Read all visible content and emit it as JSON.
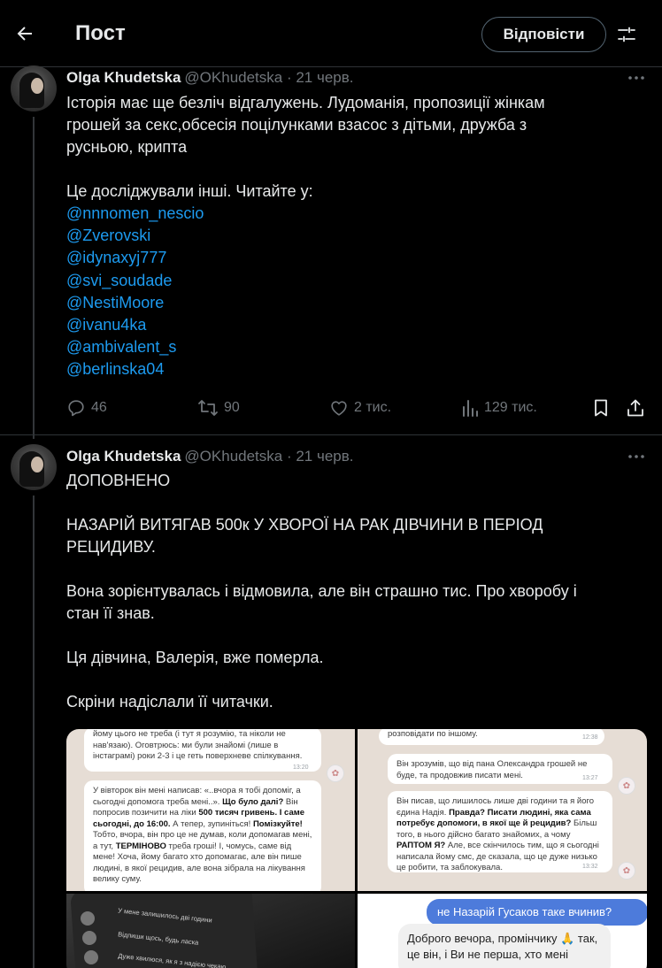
{
  "header": {
    "title": "Пост",
    "reply_label": "Відповісти"
  },
  "tweets": [
    {
      "author": "Olga Khudetska",
      "meta": "@OKhudetska · 21 черв.",
      "lines": [
        "Історія має ще безліч відгалужень. Лудоманія, пропозиції жінкам",
        "грошей за секс,обсесія поцілунками взасос з дітьми, дружба з",
        "русньою, крипта",
        "Це досліджували інші. Читайте у:"
      ],
      "mentions": [
        "@nnnomen_nescio",
        "@Zverovski",
        "@idynaxyj777",
        "@svi_soudade",
        "@NestiMoore",
        "@ivanu4ka",
        "@ambivalent_s",
        "@berlinska04"
      ],
      "stats": {
        "replies": "46",
        "reposts": "90",
        "likes": "2 тис.",
        "views": "129 тис."
      }
    },
    {
      "author": "Olga Khudetska",
      "meta": "@OKhudetska · 21 черв.",
      "lines": [
        "ДОПОВНЕНО",
        "НАЗАРІЙ ВИТЯГАВ 500к У ХВОРОЇ НА РАК ДІВЧИНИ В ПЕРІОД",
        "РЕЦИДИВУ.",
        "Вона зорієнтувалась і відмовила, але він страшно тис. Про хворобу і",
        "стан її знав.",
        "Ця дівчина, Валерія,  вже померла.",
        "Скріни надіслали її читачки."
      ],
      "media": {
        "img1": {
          "b1": "йому цього не треба (і тут я розумію, та ніколи не нав'язаю). Оговтрюсь: ми були знайомі (лише в інстаграмі) роки 2-3 і це геть поверхневе спілкування.",
          "b1_time": "13:20",
          "b2_a": "У вівторок він мені написав: «..вчора я тобі допоміг, а сьогодні допомога треба мені..». ",
          "b2_b": "Що було далі?",
          "b2_c": " Він попросив позичити на ліки ",
          "b2_d": "500 тисяч гривень. І саме сьогодні, до 16:00.",
          "b2_e": " А тепер, зупиніться! ",
          "b2_f": "Помізкуйте!",
          "b2_g": " Тобто, вчора, він про це не думав, коли допомагав мені, а тут, ",
          "b2_h": "ТЕРМІНОВО",
          "b2_i": " треба гроші! І, чомусь, саме від мене! Хоча, йому багато хто допомагає, але він пише людині, в якої рецидив, але вона зібрала на лікування велику суму."
        },
        "img2": {
          "b0": "розповідати по іншому.",
          "b0_time": "12:38",
          "b1": "Він зрозумів, що від пана Олександра грошей не буде, та продовжив писати мені.",
          "b1_time": "13:27",
          "b2_a": "Він писав, що лишилось лише дві години та я його єдина Надія. ",
          "b2_b": "Правда? Писати людині, яка сама потребує допомоги, в якої ще й рецидив?",
          "b2_c": " Більш того, в нього дійсно багато знайомих, а чому ",
          "b2_d": "РАПТОМ Я?",
          "b2_e": " Але, все скінчилось тим, що я сьогодні написала йому смс, де сказала, що це дуже низько це робити, та заблокувала.",
          "b2_time": "13:32"
        },
        "img3": {
          "row1": "У мене залишилось дві години",
          "row2": "Відпиши щось, будь ласка",
          "row3": "Дуже хвилюся, як я з надією чекаю"
        },
        "img4": {
          "blue": "не Назарій Гусаков таке вчинив?",
          "grey": "Доброго вечора, промінчику 🙏 так, це він, і Ви не перша, хто мені"
        }
      }
    }
  ],
  "icons": {
    "back": "arrow-left-icon",
    "settings": "sliders-icon",
    "more": "more-horizontal-icon",
    "reply": "comment-icon",
    "repost": "repost-icon",
    "like": "heart-icon",
    "views": "bar-chart-icon",
    "bookmark": "bookmark-icon",
    "share": "share-icon"
  },
  "colors": {
    "background": "#000000",
    "text": "#e7e9ea",
    "muted": "#71767b",
    "link": "#1d9bf0",
    "border": "#2f3336"
  }
}
